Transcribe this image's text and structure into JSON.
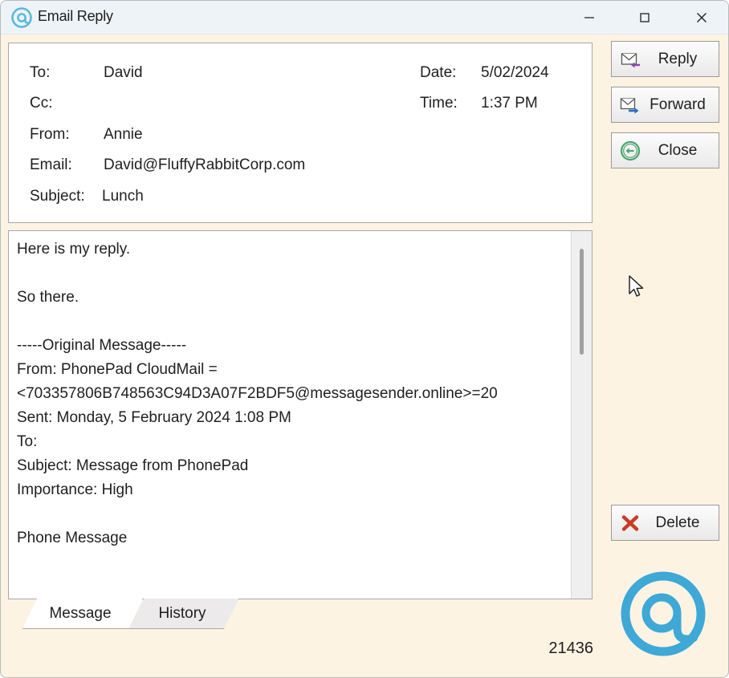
{
  "window": {
    "title": "Email Reply",
    "icon": "at-sign-icon",
    "background_color": "#FDF3E3",
    "titlebar_color": "#EEF3F7",
    "controls": [
      {
        "name": "minimize",
        "glyph": "minimize-icon"
      },
      {
        "name": "maximize",
        "glyph": "maximize-icon"
      },
      {
        "name": "close",
        "glyph": "close-icon"
      }
    ]
  },
  "header": {
    "fields": [
      {
        "label": "To:",
        "value": "David"
      },
      {
        "label": "Cc:",
        "value": ""
      },
      {
        "label": "From:",
        "value": "Annie"
      },
      {
        "label": "Email:",
        "value": "David@FluffyRabbitCorp.com"
      },
      {
        "label": "Subject:",
        "value": "Lunch"
      }
    ],
    "meta": [
      {
        "label": "Date:",
        "value": "5/02/2024"
      },
      {
        "label": "Time:",
        "value": "1:37 PM"
      }
    ]
  },
  "message": {
    "body": "Here is my reply.\n\nSo there.\n\n-----Original Message-----\nFrom: PhonePad CloudMail =\n<703357806B748563C94D3A07F2BDF5@messagesender.online>=20\nSent: Monday, 5 February 2024 1:08 PM\nTo:\nSubject: Message from PhonePad\nImportance: High\n\nPhone Message"
  },
  "tabs": [
    {
      "label": "Message",
      "active": true
    },
    {
      "label": "History",
      "active": false
    }
  ],
  "actions": [
    {
      "label": "Reply",
      "icon": "reply-envelope-icon",
      "accent": "#8E44AD"
    },
    {
      "label": "Forward",
      "icon": "forward-envelope-icon",
      "accent": "#1F6FD0"
    },
    {
      "label": "Close",
      "icon": "close-circle-arrow-icon",
      "accent": "#4CA36B"
    },
    {
      "label": "Delete",
      "icon": "delete-x-icon",
      "accent": "#CC3B24"
    }
  ],
  "status": {
    "count": "21436"
  },
  "branding": {
    "logo": "at-sign-logo",
    "logo_color": "#3EA8D6"
  }
}
